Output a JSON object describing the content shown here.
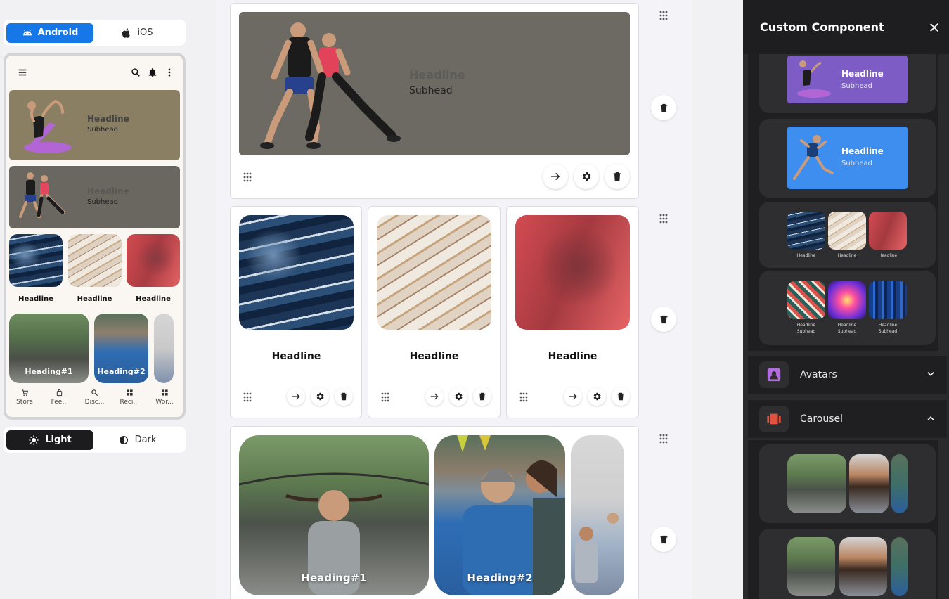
{
  "platform": {
    "android_label": "Android",
    "ios_label": "iOS",
    "selected": "Android"
  },
  "theme": {
    "light_label": "Light",
    "dark_label": "Dark",
    "selected": "Light"
  },
  "preview": {
    "hero1": {
      "headline": "Headline",
      "subhead": "Subhead"
    },
    "hero2": {
      "headline": "Headline",
      "subhead": "Subhead"
    },
    "tiles": [
      {
        "label": "Headline"
      },
      {
        "label": "Headline"
      },
      {
        "label": "Headline"
      }
    ],
    "carousel": [
      {
        "label": "Heading#1"
      },
      {
        "label": "Heading#2"
      }
    ],
    "bottom_nav": [
      {
        "label": "Store"
      },
      {
        "label": "Fee..."
      },
      {
        "label": "Disc..."
      },
      {
        "label": "Reci..."
      },
      {
        "label": "Wor..."
      }
    ]
  },
  "editor": {
    "hero": {
      "headline": "Headline",
      "subhead": "Subhead"
    },
    "tiles": [
      {
        "label": "Headline"
      },
      {
        "label": "Headline"
      },
      {
        "label": "Headline"
      }
    ],
    "carousel": [
      {
        "label": "Heading#1"
      },
      {
        "label": "Heading#2"
      }
    ]
  },
  "panel": {
    "title": "Custom Component",
    "banner_purple": {
      "headline": "Headline",
      "subhead": "Subhead"
    },
    "banner_blue": {
      "headline": "Headline",
      "subhead": "Subhead"
    },
    "mini_tiles": [
      {
        "label": "Headline"
      },
      {
        "label": "Headline"
      },
      {
        "label": "Headline"
      }
    ],
    "mini_tiles2": [
      {
        "headline": "Headline",
        "subhead": "Subhead"
      },
      {
        "headline": "Headline",
        "subhead": "Subhead"
      },
      {
        "headline": "Headline",
        "subhead": "Subhead"
      }
    ],
    "sections": [
      {
        "label": "Avatars"
      },
      {
        "label": "Carousel"
      }
    ]
  },
  "colors": {
    "accent": "#1677e8",
    "dark": "#1c1c1e",
    "panel": "#2a2a2d",
    "purple": "#7b5ac4",
    "blue": "#3e8ff0",
    "avatar_icon": "#b36ce0",
    "carousel_icon": "#e2513c"
  },
  "icons": [
    "android-icon",
    "apple-icon",
    "menu-icon",
    "search-icon",
    "bell-icon",
    "more-icon",
    "drag-handle-icon",
    "arrow-right-icon",
    "gear-icon",
    "trash-icon",
    "close-icon",
    "chevron-down-icon",
    "chevron-up-icon",
    "sun-icon",
    "moon-icon"
  ]
}
